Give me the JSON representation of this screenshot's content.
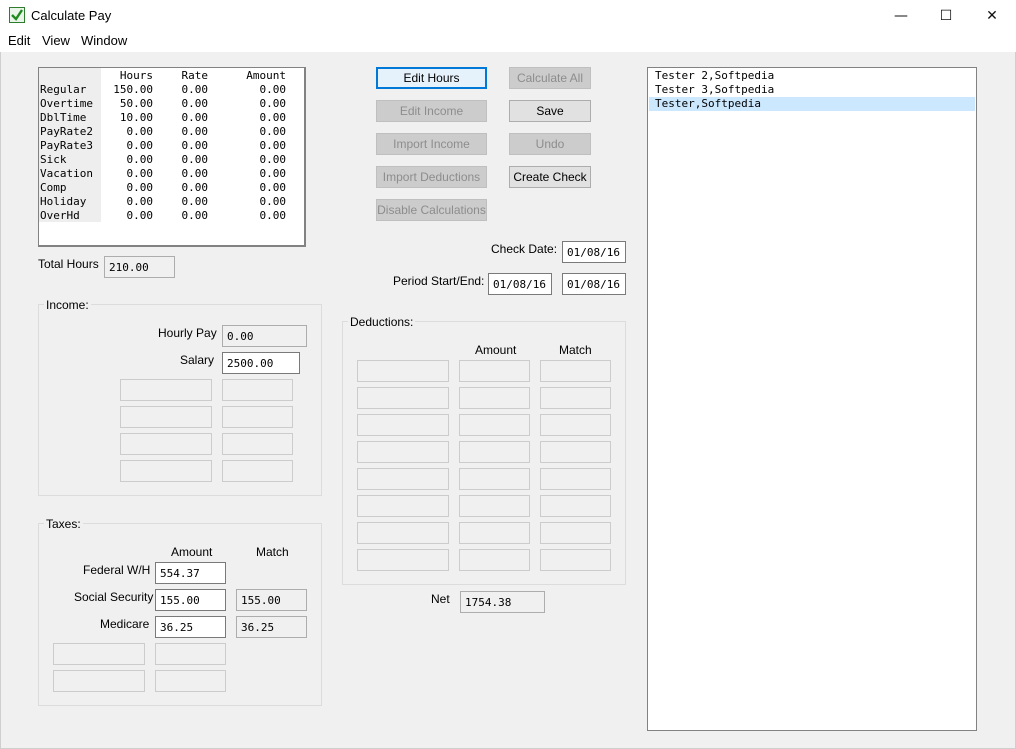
{
  "window": {
    "title": "Calculate Pay",
    "controls": {
      "minimize": "—",
      "maximize": "☐",
      "close": "✕"
    }
  },
  "menu": [
    "Edit",
    "View",
    "Window"
  ],
  "hours_table": {
    "columns": [
      "Hours",
      "Rate",
      "Amount"
    ],
    "rows": [
      {
        "name": "Regular",
        "hours": "150.00",
        "rate": "0.00",
        "amount": "0.00"
      },
      {
        "name": "Overtime",
        "hours": "50.00",
        "rate": "0.00",
        "amount": "0.00"
      },
      {
        "name": "DblTime",
        "hours": "10.00",
        "rate": "0.00",
        "amount": "0.00"
      },
      {
        "name": "PayRate2",
        "hours": "0.00",
        "rate": "0.00",
        "amount": "0.00"
      },
      {
        "name": "PayRate3",
        "hours": "0.00",
        "rate": "0.00",
        "amount": "0.00"
      },
      {
        "name": "Sick",
        "hours": "0.00",
        "rate": "0.00",
        "amount": "0.00"
      },
      {
        "name": "Vacation",
        "hours": "0.00",
        "rate": "0.00",
        "amount": "0.00"
      },
      {
        "name": "Comp",
        "hours": "0.00",
        "rate": "0.00",
        "amount": "0.00"
      },
      {
        "name": "Holiday",
        "hours": "0.00",
        "rate": "0.00",
        "amount": "0.00"
      },
      {
        "name": "OverHd",
        "hours": "0.00",
        "rate": "0.00",
        "amount": "0.00"
      }
    ]
  },
  "total_hours": {
    "label": "Total Hours",
    "value": "210.00"
  },
  "income": {
    "title": "Income:",
    "hourly_pay_label": "Hourly Pay",
    "hourly_pay": "0.00",
    "salary_label": "Salary",
    "salary": "2500.00"
  },
  "taxes": {
    "title": "Taxes:",
    "amount_header": "Amount",
    "match_header": "Match",
    "federal_label": "Federal W/H",
    "federal_amount": "554.37",
    "ss_label": "Social Security",
    "ss_amount": "155.00",
    "ss_match": "155.00",
    "medicare_label": "Medicare",
    "medicare_amount": "36.25",
    "medicare_match": "36.25"
  },
  "buttons": {
    "edit_hours": "Edit Hours",
    "calculate_all": "Calculate All",
    "edit_income": "Edit Income",
    "save": "Save",
    "import_income": "Import Income",
    "undo": "Undo",
    "import_deductions": "Import Deductions",
    "create_check": "Create Check",
    "disable_calculations": "Disable Calculations"
  },
  "check": {
    "check_date_label": "Check Date:",
    "check_date": "01/08/16",
    "period_label": "Period Start/End:",
    "period_start": "01/08/16",
    "period_end": "01/08/16"
  },
  "deductions": {
    "title": "Deductions:",
    "amount_header": "Amount",
    "match_header": "Match"
  },
  "net": {
    "label": "Net",
    "value": "1754.38"
  },
  "employees": [
    {
      "name": "Tester 2,Softpedia",
      "selected": false
    },
    {
      "name": "Tester 3,Softpedia",
      "selected": false
    },
    {
      "name": "Tester,Softpedia",
      "selected": true
    }
  ],
  "colors": {
    "selection": "#cce8ff",
    "default_button_border": "#0078d7",
    "window_bg": "#f0f0f0"
  }
}
